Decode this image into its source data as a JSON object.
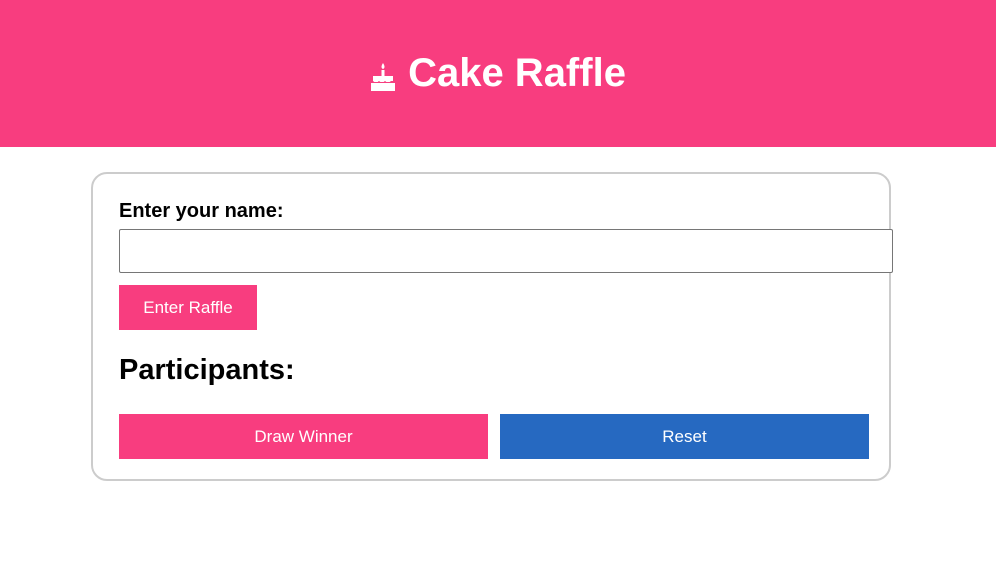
{
  "header": {
    "icon": "birthday-cake-icon",
    "title": "Cake Raffle",
    "background_color": "#f83d7f"
  },
  "form": {
    "name_label": "Enter your name:",
    "name_value": "",
    "name_placeholder": "",
    "enter_button_label": "Enter Raffle"
  },
  "participants": {
    "heading": "Participants:",
    "items": []
  },
  "actions": {
    "draw_button_label": "Draw Winner",
    "reset_button_label": "Reset",
    "draw_color": "#f83d7f",
    "reset_color": "#2669c1"
  }
}
